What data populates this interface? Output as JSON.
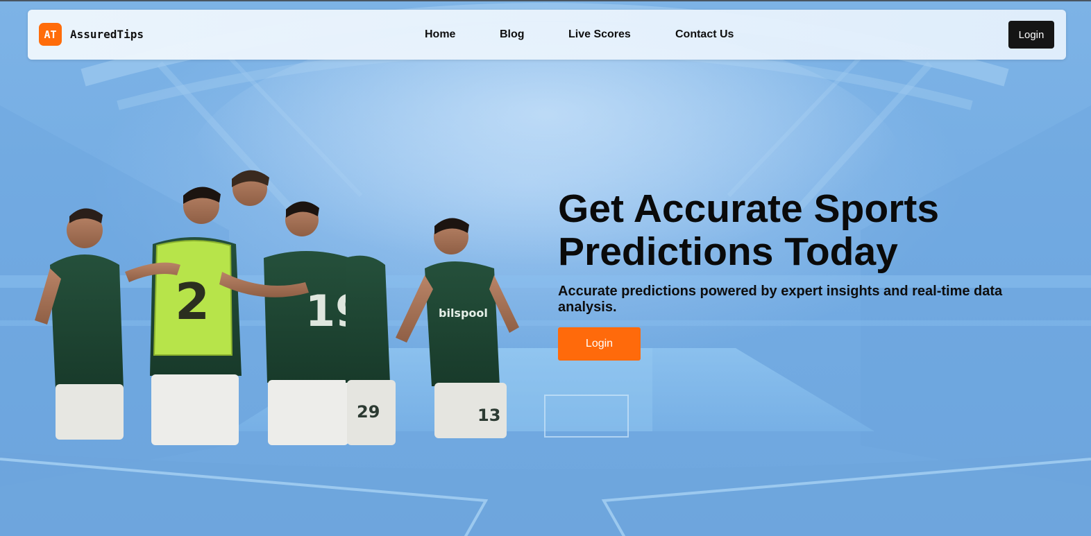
{
  "brand": {
    "badge": "AT",
    "name": "AssuredTips",
    "accent_color": "#ff6c0a"
  },
  "nav": {
    "links": [
      {
        "label": "Home"
      },
      {
        "label": "Blog"
      },
      {
        "label": "Live Scores"
      },
      {
        "label": "Contact Us"
      }
    ],
    "login_label": "Login"
  },
  "hero": {
    "title": "Get Accurate Sports Predictions Today",
    "subtitle": "Accurate predictions powered by expert insights and real-time data analysis.",
    "cta_label": "Login",
    "cta_color": "#ff6a0b"
  },
  "images": {
    "background": "stadium-background",
    "players": "celebrating-football-players",
    "jersey_numbers": [
      "2",
      "19",
      "29",
      "13"
    ]
  }
}
